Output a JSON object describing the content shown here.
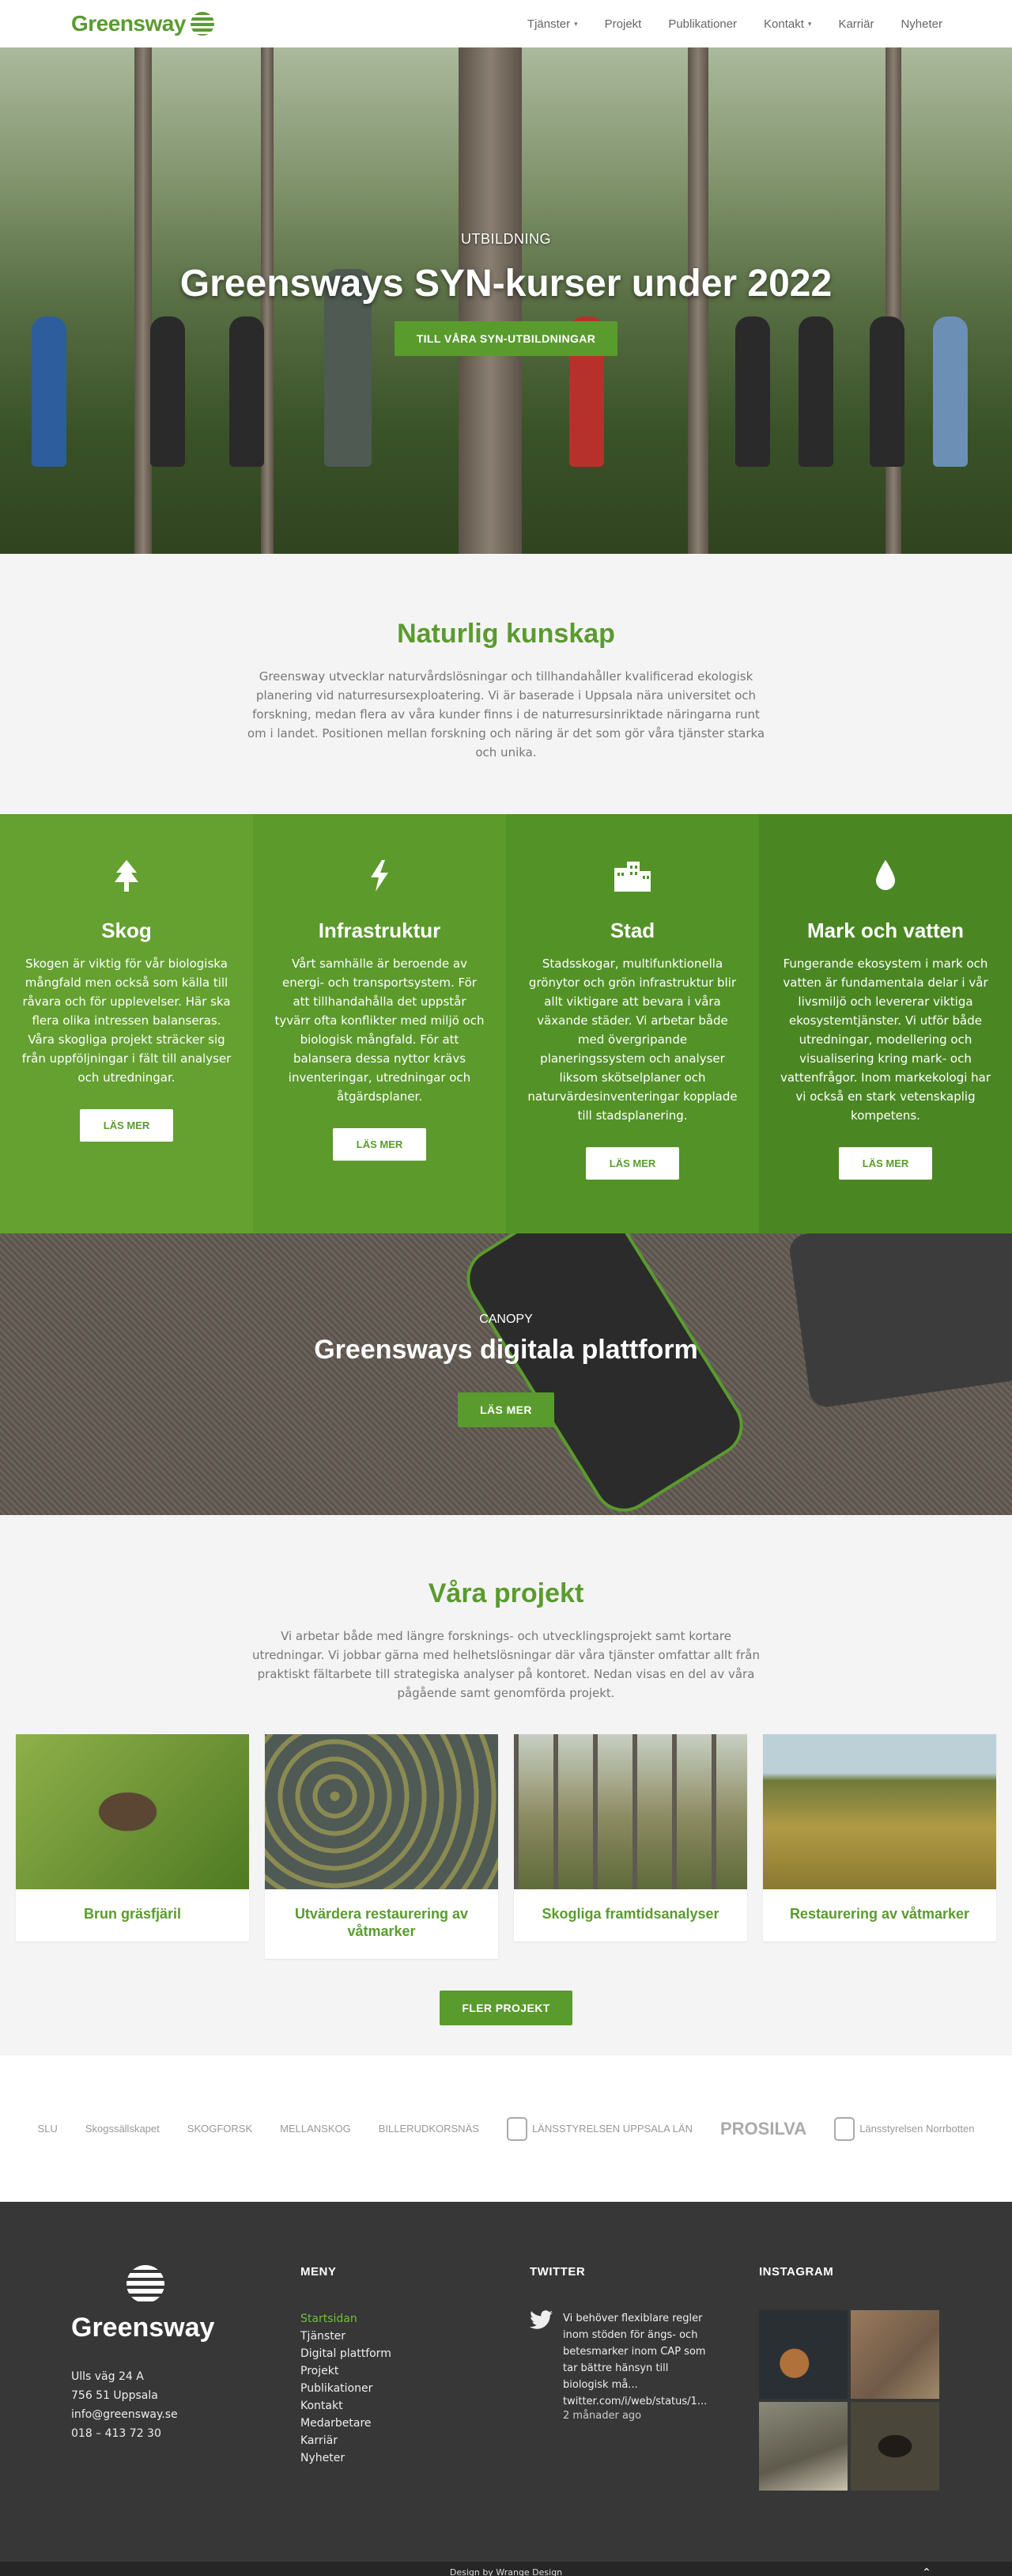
{
  "header": {
    "logo_text": "Greensway",
    "nav": [
      {
        "label": "Tjänster",
        "dropdown": true
      },
      {
        "label": "Projekt",
        "dropdown": false
      },
      {
        "label": "Publikationer",
        "dropdown": false
      },
      {
        "label": "Kontakt",
        "dropdown": true
      },
      {
        "label": "Karriär",
        "dropdown": false
      },
      {
        "label": "Nyheter",
        "dropdown": false
      }
    ]
  },
  "hero": {
    "eyebrow": "UTBILDNING",
    "title": "Greensways SYN-kurser under 2022",
    "button": "TILL VÅRA SYN-UTBILDNINGAR"
  },
  "intro": {
    "title": "Naturlig kunskap",
    "text": "Greensway utvecklar naturvårdslösningar och tillhandahåller kvalificerad ekologisk planering vid naturresursexploatering. Vi är baserade i Uppsala nära universitet och forskning, medan flera av våra kunder finns i de naturresursinriktade näringarna runt om i landet. Positionen mellan forskning och näring är det som gör våra tjänster starka och unika."
  },
  "services": [
    {
      "icon": "tree-icon",
      "title": "Skog",
      "text": "Skogen är viktig för vår biologiska mångfald men också som källa till råvara och för upplevelser. Här ska flera olika intressen balanseras. Våra skogliga projekt sträcker sig från uppföljningar i fält till analyser och utredningar.",
      "button": "LÄS MER"
    },
    {
      "icon": "bolt-icon",
      "title": "Infrastruktur",
      "text": "Vårt samhälle är beroende av energi- och transportsystem. För att tillhandahålla det uppstår tyvärr ofta konflikter med miljö och biologisk mångfald. För att balansera dessa nyttor krävs inventeringar, utredningar och åtgärdsplaner.",
      "button": "LÄS MER"
    },
    {
      "icon": "building-icon",
      "title": "Stad",
      "text": "Stadsskogar, multifunktionella grönytor och grön infrastruktur blir allt viktigare att bevara i våra växande städer. Vi arbetar både med övergripande planeringssystem och analyser liksom skötselplaner och naturvärdesinventeringar kopplade till stadsplanering.",
      "button": "LÄS MER"
    },
    {
      "icon": "water-drop-icon",
      "title": "Mark och vatten",
      "text": "Fungerande ekosystem i mark och vatten är fundamentala delar i vår livsmiljö och levererar viktiga ekosystemtjänster. Vi utför både utredningar, modellering och visualisering kring mark- och vattenfrågor. Inom markekologi har vi också en stark vetenskaplig kompetens.",
      "button": "LÄS MER"
    }
  ],
  "canopy": {
    "eyebrow": "CANOPY",
    "title": "Greensways digitala plattform",
    "button": "LÄS MER"
  },
  "projects": {
    "title": "Våra projekt",
    "text": "Vi arbetar både med längre forsknings- och utvecklingsprojekt samt kortare utredningar. Vi jobbar gärna med helhetslösningar där våra tjänster omfattar allt från praktiskt fältarbete till strategiska analyser på kontoret. Nedan visas en del av våra pågående samt genomförda projekt.",
    "cards": [
      {
        "title": "Brun gräsfjäril",
        "image": "butterfly-photo",
        "color": "#6f8f3a"
      },
      {
        "title": "Utvärdera restaurering av våtmarker",
        "image": "wetland-photo",
        "color": "#5e6a4a"
      },
      {
        "title": "Skogliga framtidsanalyser",
        "image": "forest-photo",
        "color": "#6b6a48"
      },
      {
        "title": "Restaurering av våtmarker",
        "image": "bog-photo",
        "color": "#9a8d3a"
      }
    ],
    "button": "FLER PROJEKT"
  },
  "partners": [
    "SLU",
    "Skogssällskapet",
    "SKOGFORSK",
    "MELLANSKOG",
    "BILLERUDKORSNÄS",
    "LÄNSSTYRELSEN UPPSALA LÄN",
    "PROSILVA",
    "Länsstyrelsen Norrbotten"
  ],
  "footer": {
    "brand": "Greensway",
    "contact": [
      "Ulls väg 24 A",
      "756 51 Uppsala",
      "info@greensway.se",
      "018 – 413 72 30"
    ],
    "menu_heading": "MENY",
    "menu": [
      "Startsidan",
      "Tjänster",
      "Digital plattform",
      "Projekt",
      "Publikationer",
      "Kontakt",
      "Medarbetare",
      "Karriär",
      "Nyheter"
    ],
    "twitter_heading": "TWITTER",
    "tweet_text": "Vi behöver flexiblare regler inom stöden för ängs- och betesmarker inom CAP som tar bättre hänsyn till biologisk må... twitter.com/i/web/status/1...",
    "tweet_time": "2 månader ago",
    "instagram_heading": "INSTAGRAM",
    "instagram_colors": [
      "#2a2f33",
      "#8a6c52",
      "#6d6a5c",
      "#3d3a30"
    ]
  },
  "bottom": {
    "credit": "Design by Wrange Design",
    "to_top": "⌃"
  }
}
